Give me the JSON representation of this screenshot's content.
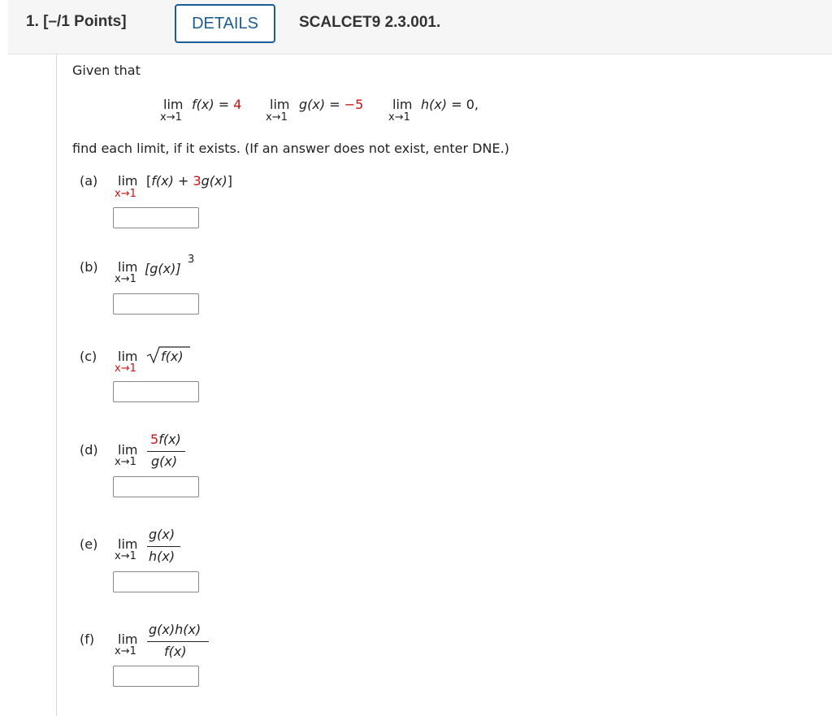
{
  "header": {
    "question_number": "1.",
    "points": "[–/1 Points]",
    "details_button": "DETAILS",
    "question_id": "SCALCET9 2.3.001."
  },
  "given_text": "Given that",
  "given": {
    "limit_f": {
      "lim": "lim",
      "sub": "x→1",
      "fx": "f(x)",
      "eq": "=",
      "value": "4"
    },
    "limit_g": {
      "lim": "lim",
      "sub": "x→1",
      "gx": "g(x)",
      "eq": "=",
      "value": "−5"
    },
    "limit_h": {
      "lim": "lim",
      "sub": "x→1",
      "hx": "h(x)",
      "eq": "=",
      "value": "0,"
    }
  },
  "instructions": "find each limit, if it exists. (If an answer does not exist, enter DNE.)",
  "parts": [
    {
      "label": "(a)",
      "lim": "lim",
      "sub": "x→1",
      "expr_open": "[",
      "f": "f(x)",
      "plus": "+",
      "coef": "3",
      "g": "g(x)",
      "expr_close": "]",
      "answer": ""
    },
    {
      "label": "(b)",
      "lim": "lim",
      "sub": "x→1",
      "expr": "[g(x)]",
      "exp": "3",
      "answer": ""
    },
    {
      "label": "(c)",
      "lim": "lim",
      "sub": "x→1",
      "radicand": "f(x)",
      "answer": ""
    },
    {
      "label": "(d)",
      "lim": "lim",
      "sub": "x→1",
      "numerator": "5f(x)",
      "numerator_coef": "5",
      "numerator_fn": "f(x)",
      "denominator": "g(x)",
      "answer": ""
    },
    {
      "label": "(e)",
      "lim": "lim",
      "sub": "x→1",
      "numerator": "g(x)",
      "denominator": "h(x)",
      "answer": ""
    },
    {
      "label": "(f)",
      "lim": "lim",
      "sub": "x→1",
      "numerator": "g(x)h(x)",
      "denominator": "f(x)",
      "answer": ""
    }
  ],
  "colors": {
    "accent": "#1c5d97",
    "highlight": "#cc1111"
  }
}
